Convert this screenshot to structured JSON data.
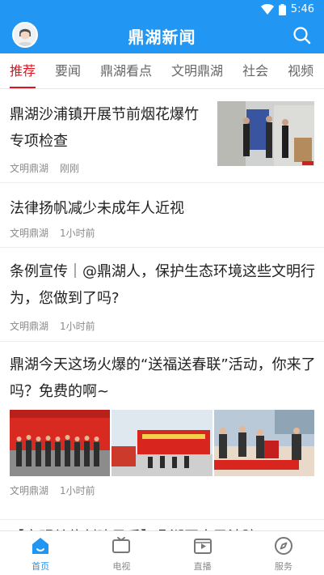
{
  "status_bar": {
    "time": "5:46"
  },
  "app_bar": {
    "title": "鼎湖新闻"
  },
  "tabs": [
    {
      "label": "推荐",
      "active": true
    },
    {
      "label": "要闻"
    },
    {
      "label": "鼎湖看点"
    },
    {
      "label": "文明鼎湖"
    },
    {
      "label": "社会"
    },
    {
      "label": "视频"
    }
  ],
  "feed": [
    {
      "title": "鼎湖沙浦镇开展节前烟花爆竹专项检查",
      "source": "文明鼎湖",
      "time": "刚刚"
    },
    {
      "title": "法律扬帆减少未成年人近视",
      "source": "文明鼎湖",
      "time": "1小时前"
    },
    {
      "title": "条例宣传｜@鼎湖人，保护生态环境这些文明行为，您做到了吗?",
      "source": "文明鼎湖",
      "time": "1小时前"
    },
    {
      "title": "鼎湖今天这场火爆的“送福送春联”活动，你来了吗？免费的啊~",
      "source": "文明鼎湖",
      "time": "1小时前"
    },
    {
      "title": "【文明单位创建风采】鼎湖区人民法院："
    }
  ],
  "bottom_nav": [
    {
      "label": "首页",
      "icon": "home-icon",
      "active": true
    },
    {
      "label": "电视",
      "icon": "tv-icon"
    },
    {
      "label": "直播",
      "icon": "live-icon"
    },
    {
      "label": "服务",
      "icon": "compass-icon"
    }
  ],
  "colors": {
    "primary": "#2196F3",
    "active_tab": "#e0141e"
  }
}
